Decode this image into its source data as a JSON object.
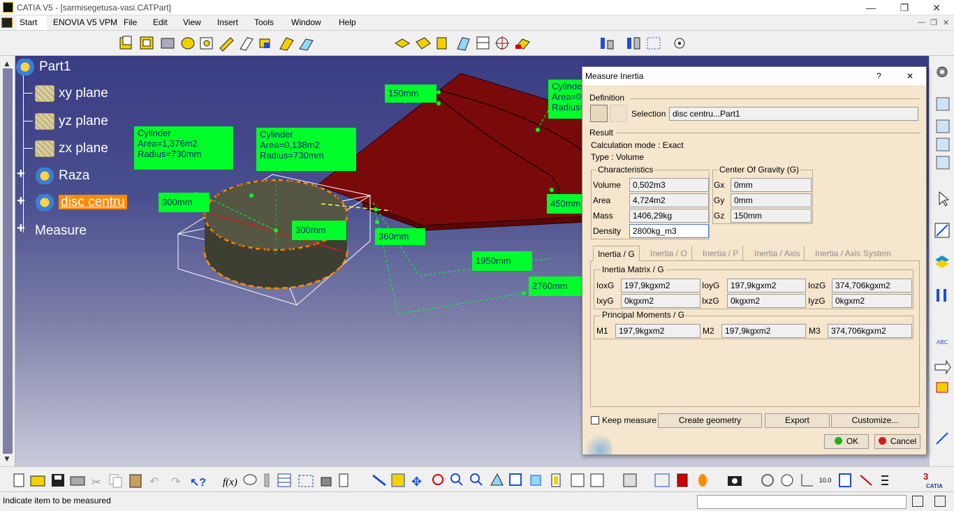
{
  "window": {
    "title": "CATIA V5 - [sarmisegetusa-vasi.CATPart]",
    "minimize": "—",
    "restore": "❐",
    "close": "✕"
  },
  "menu": {
    "start": "Start",
    "enovia": "ENOVIA V5 VPM",
    "file": "File",
    "edit": "Edit",
    "view": "View",
    "insert": "Insert",
    "tools": "Tools",
    "window": "Window",
    "help": "Help"
  },
  "tree": {
    "root": "Part1",
    "xy": "xy plane",
    "yz": "yz plane",
    "zx": "zx plane",
    "raza": "Raza",
    "disc": "disc centru",
    "measure": "Measure"
  },
  "geometry_labels": {
    "cyl1": "Cylinder\nArea=1,376m2\nRadius=730mm",
    "cyl2": "Cylinder\nArea=0,138m2\nRadius=730mm",
    "cyl3": "Cylinder\nArea=0\nRadius=",
    "d150": "150mm",
    "d300a": "300mm",
    "d300b": "300mm",
    "d360": "360mm",
    "d450": "450mm",
    "d1950": "1950mm",
    "d2760": "2760mm"
  },
  "dialog": {
    "title": "Measure Inertia",
    "help": "?",
    "close": "✕",
    "definition": "Definition",
    "selection_label": "Selection :",
    "selection_value": "disc centru...Part1",
    "result": "Result",
    "calc_mode": "Calculation mode :  Exact",
    "type": "Type :  Volume",
    "characteristics": "Characteristics",
    "volume_label": "Volume",
    "volume": "0,502m3",
    "area_label": "Area",
    "area": "4,724m2",
    "mass_label": "Mass",
    "mass": "1406,29kg",
    "density_label": "Density",
    "density": "2800kg_m3",
    "cog": "Center Of Gravity (G)",
    "gx_label": "Gx",
    "gx": "0mm",
    "gy_label": "Gy",
    "gy": "0mm",
    "gz_label": "Gz",
    "gz": "150mm",
    "tabs": [
      "Inertia / G",
      "Inertia / O",
      "Inertia / P",
      "Inertia / Axis",
      "Inertia / Axis System"
    ],
    "inertia_matrix": "Inertia Matrix / G",
    "ioxg_label": "IoxG",
    "ioxg": "197,9kgxm2",
    "ioyg_label": "IoyG",
    "ioyg": "197,9kgxm2",
    "iozg_label": "IozG",
    "iozg": "374,706kgxm2",
    "ixyg_label": "IxyG",
    "ixyg": "0kgxm2",
    "ixzg_label": "IxzG",
    "ixzg": "0kgxm2",
    "iyzg_label": "IyzG",
    "iyzg": "0kgxm2",
    "principal": "Principal Moments / G",
    "m1_label": "M1",
    "m1": "197,9kgxm2",
    "m2_label": "M2",
    "m2": "197,9kgxm2",
    "m3_label": "M3",
    "m3": "374,706kgxm2",
    "keep_measure": "Keep measure",
    "create_geometry": "Create geometry",
    "export": "Export",
    "customize": "Customize...",
    "ok": "OK",
    "cancel": "Cancel"
  },
  "status": {
    "message": "Indicate item to be measured"
  },
  "colors": {
    "label_bg": "#00ff2a",
    "selection": "#ff8a00",
    "part_red": "#7a0a0a",
    "dialog_bg": "#f6e6cd"
  }
}
